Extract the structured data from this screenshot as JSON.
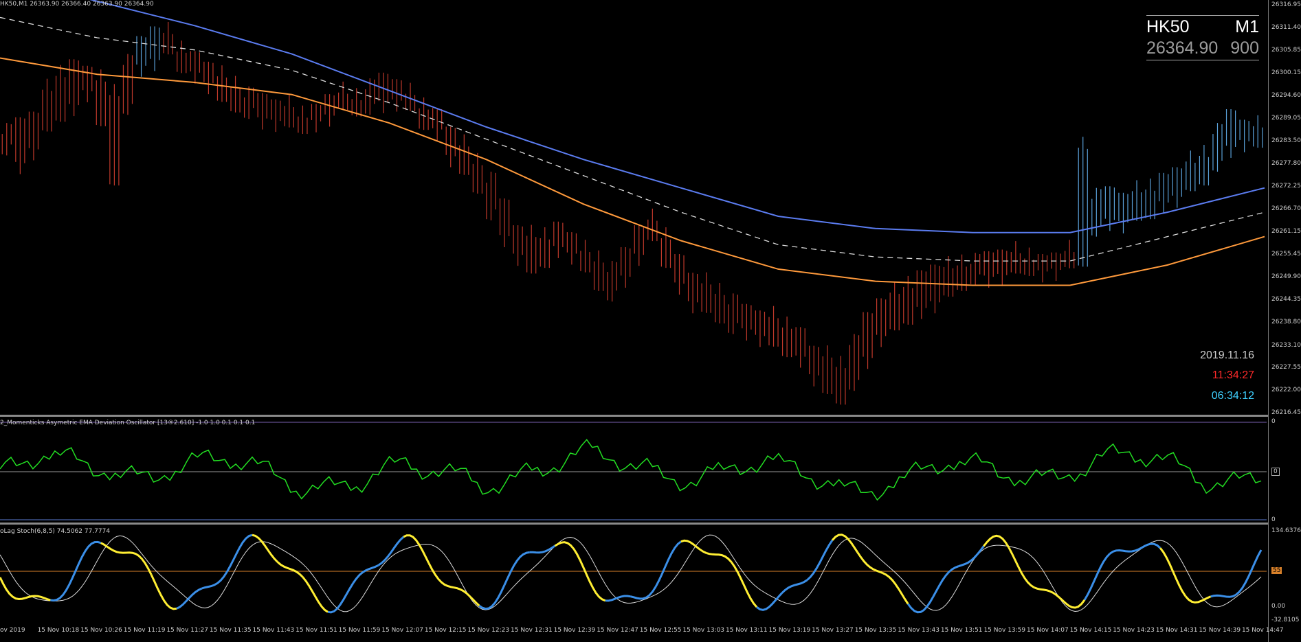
{
  "header": {
    "symbol_line": "HK50,M1  26363.90 26366.40 26363.90 26364.90"
  },
  "symbol_box": {
    "symbol": "HK50",
    "timeframe": "M1",
    "price": "26364.90",
    "spread": "900"
  },
  "clock": {
    "date": "2019.11.16",
    "time_red": "11:34:27",
    "time_cyan": "06:34:12"
  },
  "panels": {
    "osc_title": "2_Momenticks  Asymetric EMA Deviation Oscillator [13®2.610] -1.0 1.0 0.1 0.1 0.1",
    "osc_top": "0",
    "osc_mid": "0",
    "osc_bottom": "0",
    "stoch_title": "oLag Stoch(6,8,5) 74.5062 77.7774",
    "stoch_top": "134.6376",
    "stoch_level": "55",
    "stoch_zero": "0.00",
    "stoch_bottom": "-32.8105"
  },
  "colors": {
    "bear_bar": "#c0392b",
    "bull_bar": "#5aa0d8",
    "ema_blue": "#5b7cf0",
    "ema_orange": "#ff9a3c",
    "ema_dash": "#dddddd",
    "osc_line": "#22dd22",
    "stoch_blue": "#3b8fe8",
    "stoch_yellow": "#ffee33",
    "stoch_white": "#dddddd",
    "level_orange": "#d9812a"
  },
  "chart_data": {
    "type": "bar",
    "title": "HK50,M1",
    "yticks": [
      "26316.95",
      "26311.40",
      "26305.85",
      "26300.15",
      "26294.60",
      "26289.05",
      "26283.50",
      "26277.80",
      "26272.25",
      "26266.70",
      "26261.15",
      "26255.45",
      "26249.90",
      "26244.35",
      "26238.80",
      "26233.10",
      "26227.55",
      "26222.00",
      "26216.45"
    ],
    "ylim": [
      26216.45,
      26316.95
    ],
    "xticks": [
      "ov 2019",
      "15 Nov 10:18",
      "15 Nov 10:26",
      "15 Nov 11:19",
      "15 Nov 11:27",
      "15 Nov 11:35",
      "15 Nov 11:43",
      "15 Nov 11:51",
      "15 Nov 11:59",
      "15 Nov 12:07",
      "15 Nov 12:15",
      "15 Nov 12:23",
      "15 Nov 12:31",
      "15 Nov 12:39",
      "15 Nov 12:47",
      "15 Nov 12:55",
      "15 Nov 13:03",
      "15 Nov 13:11",
      "15 Nov 13:19",
      "15 Nov 13:27",
      "15 Nov 13:35",
      "15 Nov 13:43",
      "15 Nov 13:51",
      "15 Nov 13:59",
      "15 Nov 14:07",
      "15 Nov 14:15",
      "15 Nov 14:23",
      "15 Nov 14:31",
      "15 Nov 14:39",
      "15 Nov 14:47"
    ],
    "price_bars_low_high": [
      [
        26280,
        26288
      ],
      [
        26276,
        26290
      ],
      [
        26280,
        26292
      ],
      [
        26285,
        26298
      ],
      [
        26288,
        26302
      ],
      [
        26290,
        26304
      ],
      [
        26294,
        26303
      ],
      [
        26286,
        26300
      ],
      [
        26272,
        26297
      ],
      [
        26290,
        26305
      ],
      [
        26300,
        26310
      ],
      [
        26302,
        26313
      ],
      [
        26304,
        26312
      ],
      [
        26300,
        26308
      ],
      [
        26298,
        26306
      ],
      [
        26296,
        26304
      ],
      [
        26292,
        26301
      ],
      [
        26290,
        26299
      ],
      [
        26289,
        26297
      ],
      [
        26287,
        26296
      ],
      [
        26287,
        26295
      ],
      [
        26286,
        26294
      ],
      [
        26285,
        26292
      ],
      [
        26286,
        26293
      ],
      [
        26288,
        26296
      ],
      [
        26290,
        26297
      ],
      [
        26289,
        26296
      ],
      [
        26290,
        26299
      ],
      [
        26291,
        26301
      ],
      [
        26292,
        26300
      ],
      [
        26290,
        26297
      ],
      [
        26286,
        26294
      ],
      [
        26284,
        26292
      ],
      [
        26278,
        26288
      ],
      [
        26274,
        26284
      ],
      [
        26270,
        26280
      ],
      [
        26264,
        26276
      ],
      [
        26258,
        26270
      ],
      [
        26254,
        26264
      ],
      [
        26250,
        26262
      ],
      [
        26252,
        26262
      ],
      [
        26255,
        26264
      ],
      [
        26254,
        26262
      ],
      [
        26250,
        26258
      ],
      [
        26246,
        26256
      ],
      [
        26244,
        26254
      ],
      [
        26248,
        26258
      ],
      [
        26254,
        26264
      ],
      [
        26258,
        26266
      ],
      [
        26252,
        26262
      ],
      [
        26246,
        26256
      ],
      [
        26242,
        26252
      ],
      [
        26240,
        26250
      ],
      [
        26238,
        26248
      ],
      [
        26236,
        26246
      ],
      [
        26235,
        26244
      ],
      [
        26234,
        26243
      ],
      [
        26232,
        26242
      ],
      [
        26230,
        26240
      ],
      [
        26228,
        26238
      ],
      [
        26224,
        26234
      ],
      [
        26220,
        26232
      ],
      [
        26218,
        26230
      ],
      [
        26222,
        26236
      ],
      [
        26228,
        26242
      ],
      [
        26234,
        26246
      ],
      [
        26236,
        26248
      ],
      [
        26238,
        26250
      ],
      [
        26240,
        26252
      ],
      [
        26242,
        26254
      ],
      [
        26244,
        26254
      ],
      [
        26246,
        26255
      ],
      [
        26248,
        26256
      ],
      [
        26248,
        26257
      ],
      [
        26249,
        26258
      ],
      [
        26250,
        26258
      ],
      [
        26250,
        26257
      ],
      [
        26249,
        26256
      ],
      [
        26250,
        26257
      ],
      [
        26251,
        26258
      ],
      [
        26252,
        26284
      ],
      [
        26260,
        26272
      ],
      [
        26262,
        26273
      ],
      [
        26262,
        26272
      ],
      [
        26263,
        26273
      ],
      [
        26264,
        26274
      ],
      [
        26266,
        26276
      ],
      [
        26268,
        26278
      ],
      [
        26270,
        26280
      ],
      [
        26272,
        26282
      ],
      [
        26276,
        26288
      ],
      [
        26280,
        26292
      ],
      [
        26282,
        26290
      ],
      [
        26281,
        26289
      ]
    ],
    "series": [
      {
        "name": "EMA upper",
        "values": [
          26324,
          26318,
          26312,
          26305,
          26296,
          26287,
          26279,
          26272,
          26265,
          26262,
          26261,
          26261,
          26266,
          26272
        ]
      },
      {
        "name": "EMA mid",
        "values": [
          26314,
          26309,
          26306,
          26301,
          26293,
          26284,
          26275,
          26266,
          26258,
          26255,
          26254,
          26254,
          26260,
          26266
        ]
      },
      {
        "name": "EMA lower",
        "values": [
          26304,
          26300,
          26298,
          26295,
          26288,
          26279,
          26268,
          26259,
          26252,
          26249,
          26248,
          26248,
          26253,
          26260
        ]
      }
    ]
  }
}
